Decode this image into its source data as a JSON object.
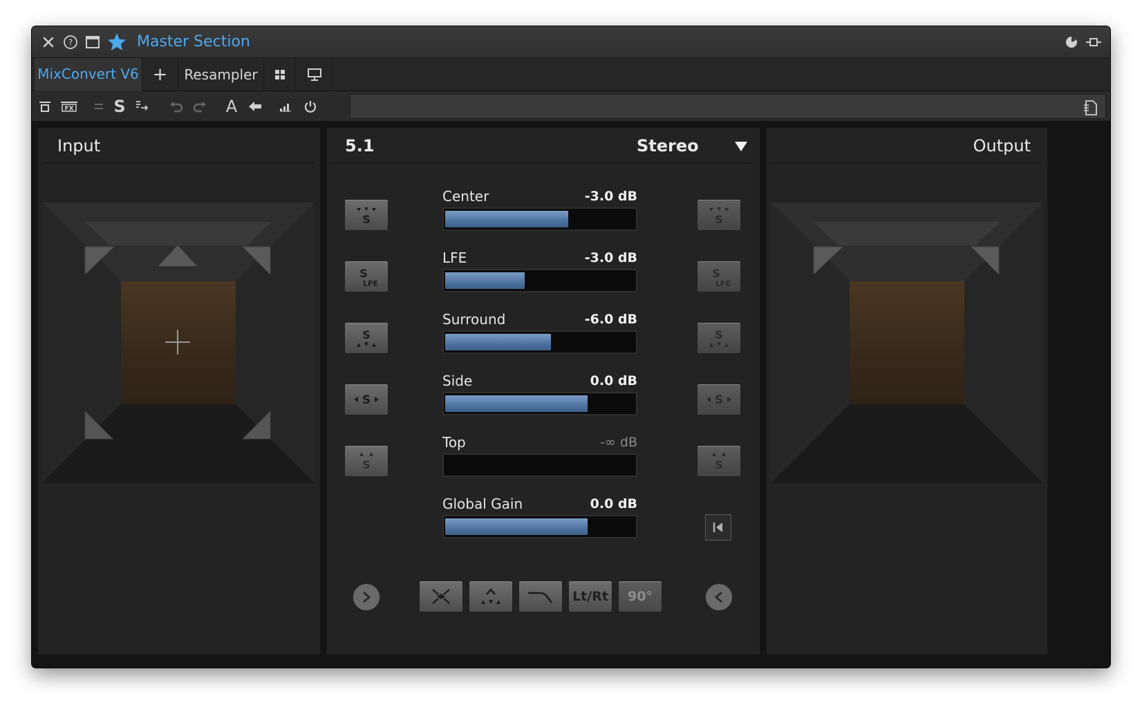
{
  "window": {
    "title": "Master Section",
    "accent_color": "#4ea8ee"
  },
  "titlebar": {
    "icons": [
      "close-icon",
      "help-icon",
      "window-icon",
      "star-icon",
      "pie-icon",
      "pin-icon"
    ]
  },
  "tabs": {
    "items": [
      {
        "label": "MixConvert V6",
        "active": true
      },
      {
        "label": "Resampler",
        "active": false
      }
    ],
    "add_label": "+"
  },
  "toolbar": {
    "fx_label": "FX",
    "s_label": "S",
    "a_label": "A"
  },
  "input_panel": {
    "title": "Input"
  },
  "center_panel": {
    "source_format": "5.1",
    "target_format": "Stereo",
    "channels": [
      {
        "label": "Center",
        "value": "-3.0 dB",
        "level": 0.65
      },
      {
        "label": "LFE",
        "value": "-3.0 dB",
        "level": 0.42
      },
      {
        "label": "Surround",
        "value": "-6.0 dB",
        "level": 0.56
      },
      {
        "label": "Side",
        "value": "0.0 dB",
        "level": 0.75
      },
      {
        "label": "Top",
        "value": "-∞ dB",
        "level": 0.0
      },
      {
        "label": "Global Gain",
        "value": "0.0 dB",
        "level": 0.75
      }
    ],
    "bottom_buttons": [
      {
        "label": "",
        "icon": "spread-icon"
      },
      {
        "label": "",
        "icon": "top-speakers-icon"
      },
      {
        "label": "",
        "icon": "curve-icon"
      },
      {
        "label": "Lt/Rt",
        "icon": ""
      },
      {
        "label": "90°",
        "icon": ""
      }
    ],
    "lfe_text": "LFE",
    "s_text": "S"
  },
  "output_panel": {
    "title": "Output"
  }
}
